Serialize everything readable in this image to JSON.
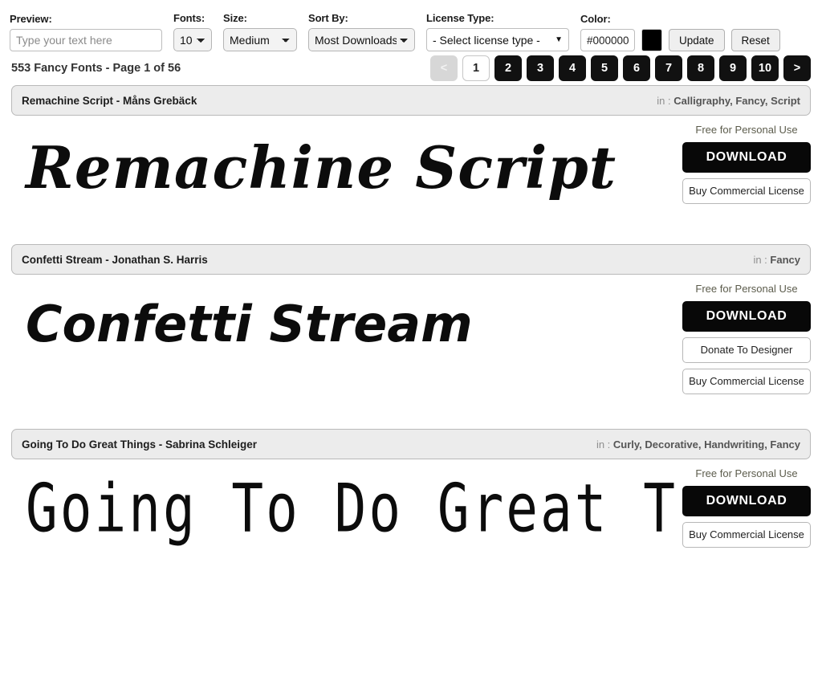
{
  "toolbar": {
    "preview": {
      "label": "Preview:",
      "placeholder": "Type your text here",
      "value": ""
    },
    "fonts": {
      "label": "Fonts:",
      "value": "10"
    },
    "size": {
      "label": "Size:",
      "value": "Medium"
    },
    "sort_by": {
      "label": "Sort By:",
      "value": "Most Downloads"
    },
    "license_type": {
      "label": "License Type:",
      "value": "- Select license type -"
    },
    "color": {
      "label": "Color:",
      "value": "#000000",
      "swatch_hex": "#000000"
    },
    "update_label": "Update",
    "reset_label": "Reset"
  },
  "results": {
    "count_text": "553 Fancy Fonts - Page 1 of 56"
  },
  "pagination": {
    "prev_label": "<",
    "next_label": ">",
    "pages": [
      "1",
      "2",
      "3",
      "4",
      "5",
      "6",
      "7",
      "8",
      "9",
      "10"
    ],
    "current_page": "1"
  },
  "cards": [
    {
      "title": "Remachine Script - Måns Grebäck",
      "tags_prefix": "in : ",
      "tags": "Calligraphy, Fancy, Script",
      "preview_text": "Remachine Script",
      "license_note": "Free for Personal Use",
      "download_label": "DOWNLOAD",
      "donate_label": null,
      "commercial_label": "Buy Commercial License"
    },
    {
      "title": "Confetti Stream - Jonathan S. Harris",
      "tags_prefix": "in : ",
      "tags": "Fancy",
      "preview_text": "Confetti Stream",
      "license_note": "Free for Personal Use",
      "download_label": "DOWNLOAD",
      "donate_label": "Donate To Designer",
      "commercial_label": "Buy Commercial License"
    },
    {
      "title": "Going To Do Great Things - Sabrina Schleiger",
      "tags_prefix": "in : ",
      "tags": "Curly, Decorative, Handwriting, Fancy",
      "preview_text": "Going To Do Great Thi",
      "license_note": "Free for Personal Use",
      "download_label": "DOWNLOAD",
      "donate_label": null,
      "commercial_label": "Buy Commercial License"
    }
  ]
}
